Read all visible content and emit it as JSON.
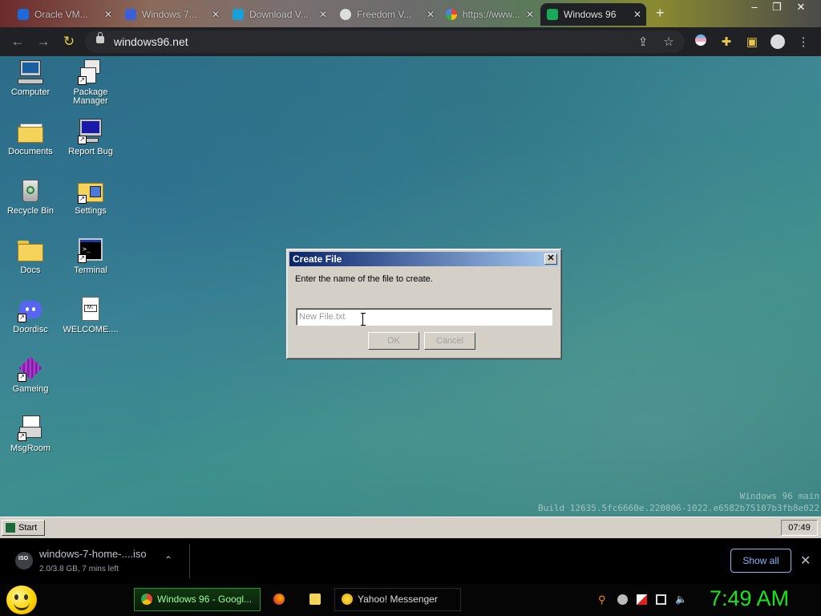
{
  "browser": {
    "tabs": [
      {
        "label": "Oracle VM..."
      },
      {
        "label": "Windows 7..."
      },
      {
        "label": "Download V..."
      },
      {
        "label": "Freedom V..."
      },
      {
        "label": "https://www..."
      },
      {
        "label": "Windows 96"
      }
    ],
    "url": "windows96.net"
  },
  "desktop": {
    "icons": [
      {
        "label": "Computer"
      },
      {
        "label": "Package Manager"
      },
      {
        "label": "Documents"
      },
      {
        "label": "Report Bug"
      },
      {
        "label": "Recycle Bin"
      },
      {
        "label": "Settings"
      },
      {
        "label": "Docs"
      },
      {
        "label": "Terminal"
      },
      {
        "label": "Doordisc"
      },
      {
        "label": "WELCOME...."
      },
      {
        "label": "Gameing"
      },
      {
        "label": "MsgRoom"
      }
    ],
    "build_line1": "Windows 96 main",
    "build_line2": "Build 12635.5fc6660e.220806-1022.e6582b75107b3fb8e022"
  },
  "dialog": {
    "title": "Create File",
    "prompt": "Enter the name of the file to create.",
    "input_placeholder": "New File.txt",
    "input_value": "",
    "ok_label": "OK",
    "cancel_label": "Cancel"
  },
  "w96_taskbar": {
    "start_label": "Start",
    "clock": "07:49"
  },
  "downloads": {
    "filename": "windows-7-home-....iso",
    "status": "2.0/3.8 GB, 7 mins left",
    "show_all_label": "Show all"
  },
  "host_taskbar": {
    "tasks": [
      {
        "label": "Windows 96 - Googl..."
      },
      {
        "label": "Yahoo! Messenger"
      }
    ],
    "clock": "7:49 AM"
  },
  "colors": {
    "titlebar_start": "#0a246a",
    "titlebar_end": "#a6caf0",
    "host_clock": "#19e61a",
    "show_all_accent": "#8ab4f8"
  }
}
